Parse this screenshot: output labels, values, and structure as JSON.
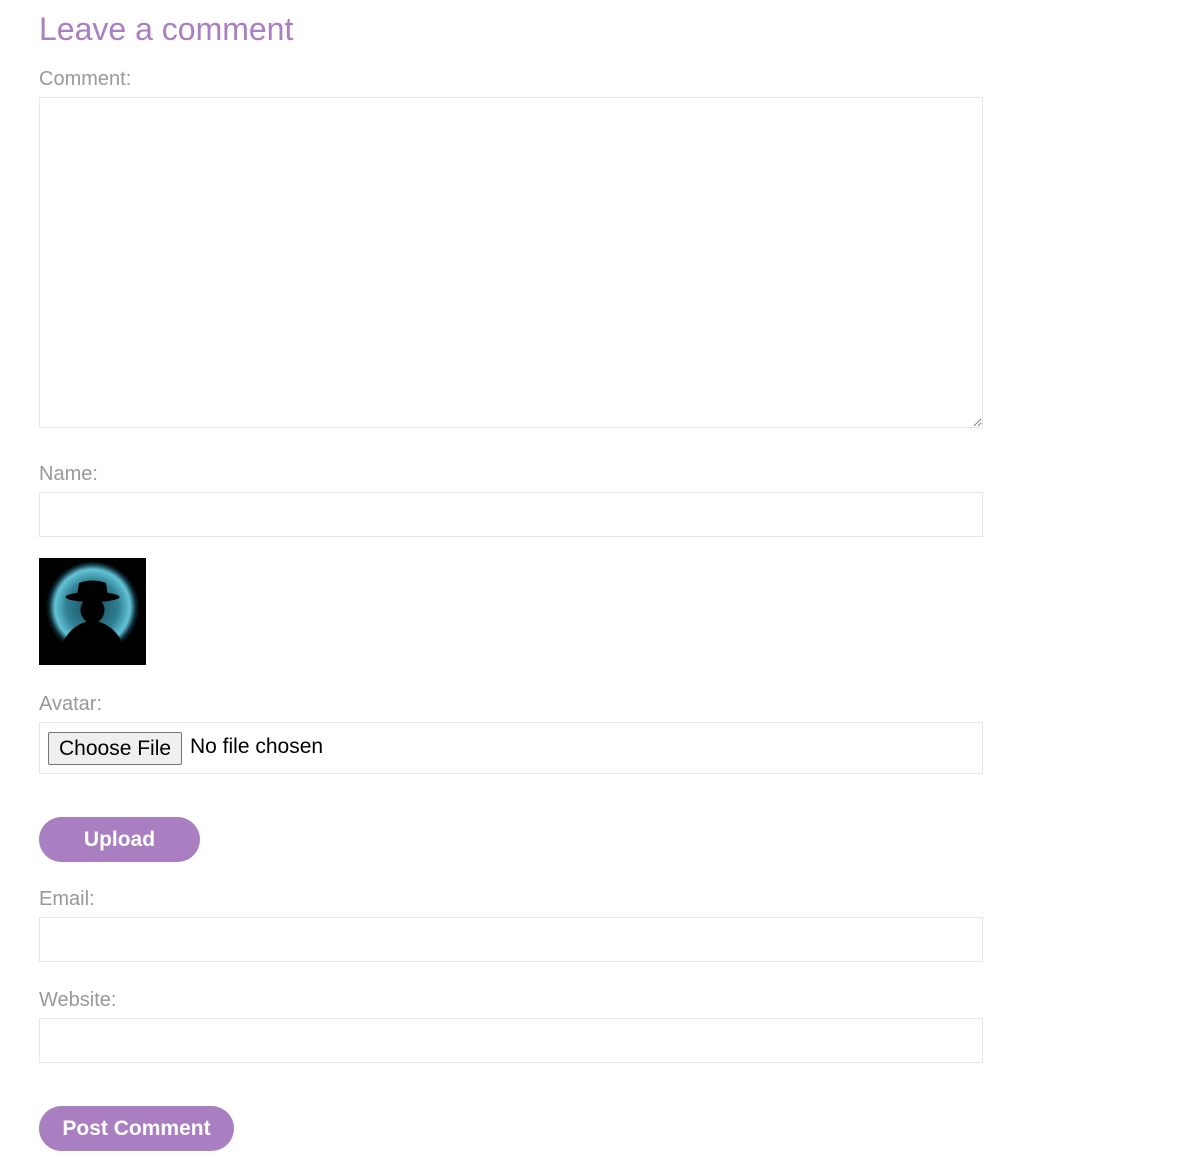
{
  "form": {
    "heading": "Leave a comment",
    "comment_label": "Comment:",
    "comment_value": "",
    "name_label": "Name:",
    "name_value": "",
    "avatar_label": "Avatar:",
    "choose_file_label": "Choose File",
    "file_status": "No file chosen",
    "upload_label": "Upload",
    "email_label": "Email:",
    "email_value": "",
    "website_label": "Website:",
    "website_value": "",
    "submit_label": "Post Comment"
  },
  "avatar": {
    "icon": "hat-silhouette-avatar-icon"
  },
  "colors": {
    "accent": "#a97fc2",
    "label": "#999999",
    "border": "#e6e6e6",
    "button_text": "#ffffff"
  }
}
